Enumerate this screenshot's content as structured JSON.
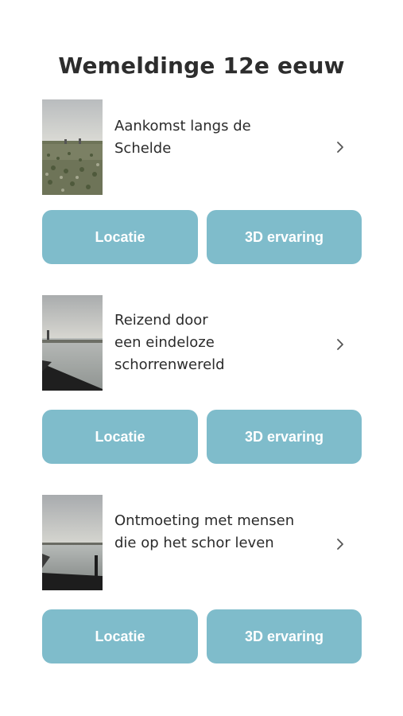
{
  "page": {
    "title": "Wemeldinge 12e eeuw"
  },
  "episodes": [
    {
      "title": "Aankomst langs de\nSchelde",
      "thumbnail_icon": "field-landscape-photo",
      "chevron_icon": "chevron-right-icon",
      "location_label": "Locatie",
      "experience_label": "3D ervaring"
    },
    {
      "title": "Reizend door\neen eindeloze\nschorrenwereld",
      "thumbnail_icon": "water-landscape-photo",
      "chevron_icon": "chevron-right-icon",
      "location_label": "Locatie",
      "experience_label": "3D ervaring"
    },
    {
      "title": "Ontmoeting met mensen\ndie op het schor leven",
      "thumbnail_icon": "water-landscape-photo",
      "chevron_icon": "chevron-right-icon",
      "location_label": "Locatie",
      "experience_label": "3D ervaring"
    }
  ],
  "colors": {
    "button_bg": "#7fbccb",
    "button_text": "#ffffff",
    "title_text": "#2d2d2d"
  }
}
